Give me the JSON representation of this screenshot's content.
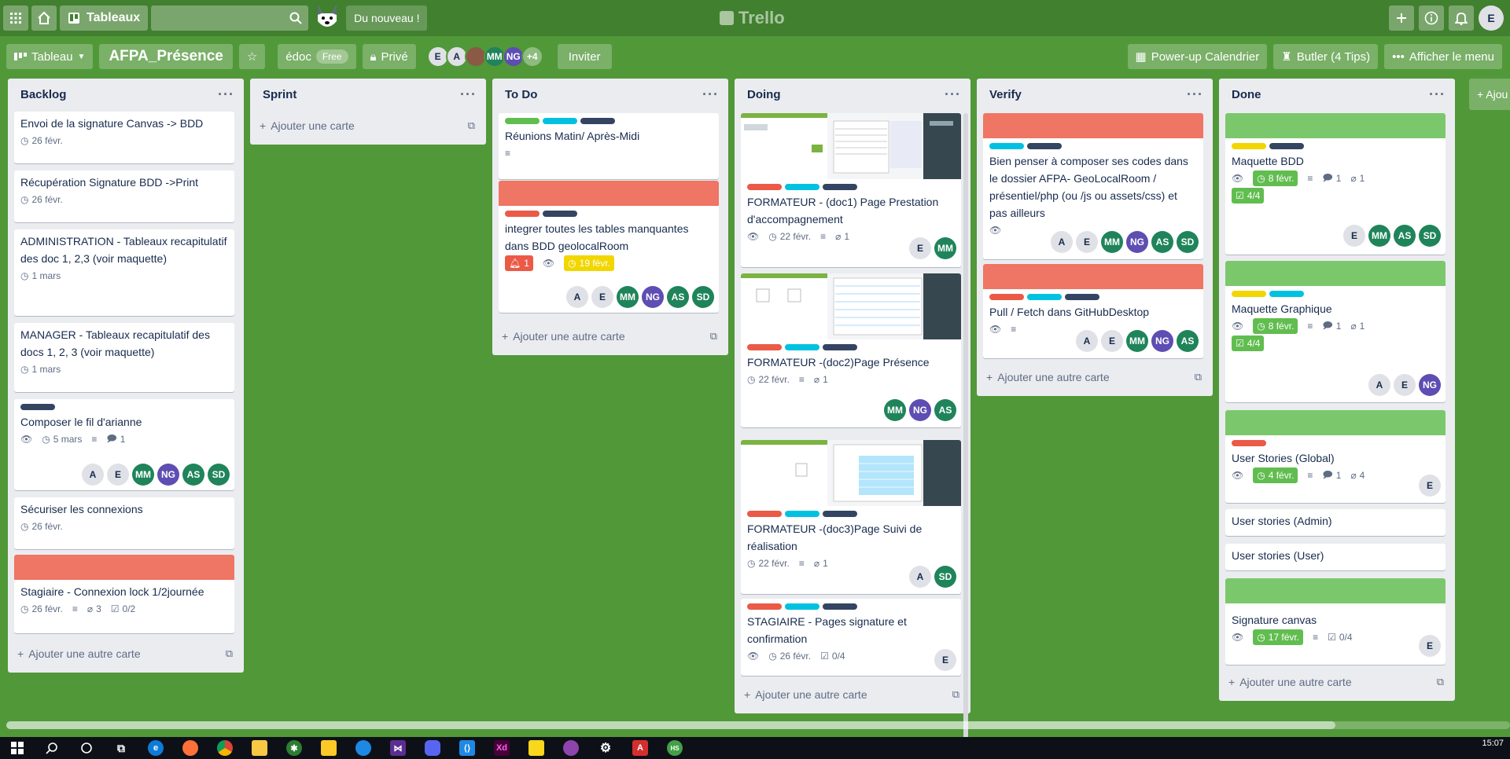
{
  "topbar": {
    "boards_label": "Tableaux",
    "whats_new": "Du nouveau !",
    "logo": "Trello",
    "user_initial": "E"
  },
  "board": {
    "view_label": "Tableau",
    "title": "AFPA_Présence",
    "workspace": "édoc",
    "workspace_plan": "Free",
    "visibility": "Privé",
    "members_more": "+4",
    "invite": "Inviter",
    "powerup": "Power-up Calendrier",
    "butler": "Butler (4 Tips)",
    "menu": "Afficher le menu",
    "add_list": "+ Ajou"
  },
  "add_card_label": "Ajouter une autre carte",
  "add_first_card_label": "Ajouter une carte",
  "lists": [
    {
      "name": "Backlog",
      "cards": [
        {
          "title": "Envoi de la signature Canvas -> BDD",
          "due": "26 févr."
        },
        {
          "title": "Récupération Signature BDD ->Print",
          "due": "26 févr."
        },
        {
          "title": "ADMINISTRATION - Tableaux recapitulatif des doc 1, 2,3 (voir maquette)",
          "due": "1 mars"
        },
        {
          "title": "MANAGER - Tableaux recapitulatif des docs 1, 2, 3 (voir maquette)",
          "due": "1 mars"
        },
        {
          "title": "Composer le fil d'arianne",
          "due": "5 mars",
          "comments": "1",
          "members": [
            "A",
            "E",
            "MM",
            "NG",
            "AS",
            "SD"
          ]
        },
        {
          "title": "Sécuriser les connexions",
          "due": "26 févr."
        },
        {
          "title": "Stagiaire - Connexion lock 1/2journée",
          "due": "26 févr.",
          "attachments": "3",
          "checklist": "0/2"
        }
      ]
    },
    {
      "name": "Sprint",
      "cards": []
    },
    {
      "name": "To Do",
      "cards": [
        {
          "title": "Réunions Matin/ Après-Midi"
        },
        {
          "title": "integrer toutes les tables manquantes dans BDD geolocalRoom",
          "notifications": "1",
          "due": "19 févr.",
          "members": [
            "A",
            "E",
            "MM",
            "NG",
            "AS",
            "SD"
          ]
        }
      ]
    },
    {
      "name": "Doing",
      "cards": [
        {
          "title": "FORMATEUR - (doc1) Page Prestation d'accompagnement",
          "due": "22 févr.",
          "attachments": "1",
          "members": [
            "E",
            "MM"
          ]
        },
        {
          "title": "FORMATEUR -(doc2)Page Présence",
          "due": "22 févr.",
          "attachments": "1",
          "members": [
            "MM",
            "NG",
            "AS"
          ]
        },
        {
          "title": "FORMATEUR -(doc3)Page Suivi de réalisation",
          "due": "22 févr.",
          "attachments": "1",
          "members": [
            "A",
            "SD"
          ]
        },
        {
          "title": "STAGIAIRE - Pages signature et confirmation",
          "due": "26 févr.",
          "checklist": "0/4",
          "members": [
            "E"
          ]
        }
      ]
    },
    {
      "name": "Verify",
      "cards": [
        {
          "title": "Bien penser à composer ses codes dans le dossier AFPA- GeoLocalRoom / présentiel/php (ou /js ou assets/css) et pas ailleurs",
          "members": [
            "A",
            "E",
            "MM",
            "NG",
            "AS",
            "SD"
          ]
        },
        {
          "title": "Pull / Fetch dans GitHubDesktop",
          "members": [
            "A",
            "E",
            "MM",
            "NG",
            "AS"
          ]
        }
      ]
    },
    {
      "name": "Done",
      "cards": [
        {
          "title": "Maquette BDD",
          "due": "8 févr.",
          "comments": "1",
          "attachments": "1",
          "checklist": "4/4",
          "members": [
            "E",
            "MM",
            "AS",
            "SD"
          ]
        },
        {
          "title": "Maquette Graphique",
          "due": "8 févr.",
          "comments": "1",
          "attachments": "1",
          "checklist": "4/4",
          "members": [
            "A",
            "E",
            "NG"
          ]
        },
        {
          "title": "User Stories (Global)",
          "due": "4 févr.",
          "comments": "1",
          "attachments": "4",
          "members": [
            "E"
          ]
        },
        {
          "title": "User stories (Admin)"
        },
        {
          "title": "User stories (User)"
        },
        {
          "title": "Signature canvas",
          "due": "17 févr.",
          "checklist": "0/4",
          "members": [
            "E"
          ]
        }
      ]
    }
  ],
  "colors": {
    "background": "#519839",
    "green": "#61bd4f",
    "yellow": "#f2d600",
    "red": "#eb5a46",
    "sky": "#00c2e0",
    "navy": "#344563",
    "cover_red": "#ef7564",
    "cover_green": "#7bc86c"
  },
  "taskbar": {
    "time": "15:07"
  }
}
